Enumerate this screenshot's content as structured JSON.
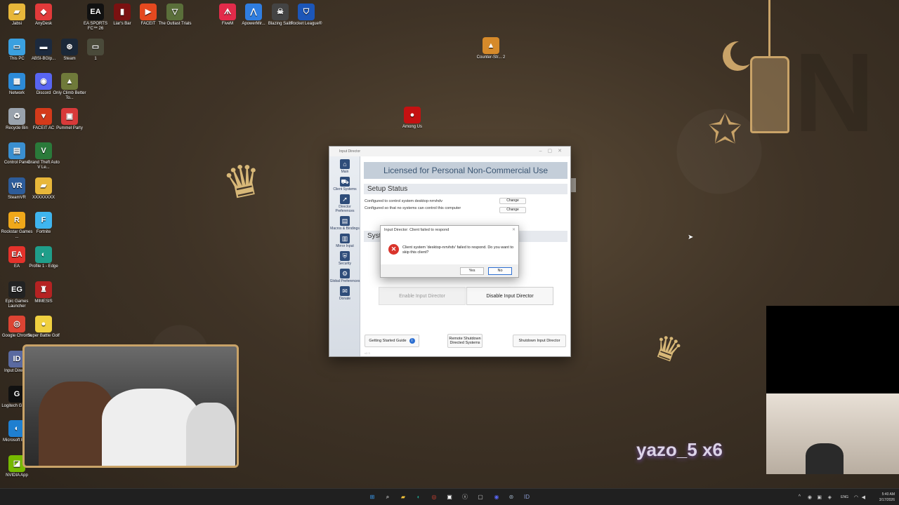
{
  "desktop": {
    "icons": [
      {
        "label": "Jabsi",
        "glyph": "▰",
        "color": "#e8b73a"
      },
      {
        "label": "AnyDesk",
        "glyph": "◆",
        "color": "#e23a3a"
      },
      {
        "label": "EA SPORTS FC™ 26",
        "glyph": "EA",
        "color": "#111111"
      },
      {
        "label": "Liar's Bar",
        "glyph": "▮",
        "color": "#7a1111"
      },
      {
        "label": "FACEIT",
        "glyph": "▶",
        "color": "#e5491f"
      },
      {
        "label": "The Outlast Trials",
        "glyph": "▽",
        "color": "#5a6f3a"
      },
      {
        "label": "FiveM",
        "glyph": "ᗑ",
        "color": "#e32b4a"
      },
      {
        "label": "ApowerMir...",
        "glyph": "⋀",
        "color": "#2f7de0"
      },
      {
        "label": "Blazing Sails",
        "glyph": "☠",
        "color": "#444444"
      },
      {
        "label": "Rocket League®",
        "glyph": "⛉",
        "color": "#1c56b8"
      },
      {
        "label": "Counter-Str... 2",
        "glyph": "▲",
        "color": "#d68a2a"
      },
      {
        "label": "This PC",
        "glyph": "▭",
        "color": "#3aa0e0"
      },
      {
        "label": "ABSI-BGIp...",
        "glyph": "▬",
        "color": "#1c2a3e"
      },
      {
        "label": "Steam",
        "glyph": "⊛",
        "color": "#1b2838"
      },
      {
        "label": "1",
        "glyph": "▭",
        "color": "#4a4a3a"
      },
      {
        "label": "Network",
        "glyph": "▦",
        "color": "#2d8bd8"
      },
      {
        "label": "Discord",
        "glyph": "◉",
        "color": "#5865f2"
      },
      {
        "label": "Only Climb Better To...",
        "glyph": "▲",
        "color": "#6f7a3a"
      },
      {
        "label": "Among Us",
        "glyph": "●",
        "color": "#c51111"
      },
      {
        "label": "Recycle Bin",
        "glyph": "♻",
        "color": "#9aa3ad"
      },
      {
        "label": "FACEIT AC",
        "glyph": "▼",
        "color": "#d43a1a"
      },
      {
        "label": "Pummel Party",
        "glyph": "▣",
        "color": "#d83a3a"
      },
      {
        "label": "Control Panel",
        "glyph": "▤",
        "color": "#3a8fd0"
      },
      {
        "label": "Grand Theft Auto V Le...",
        "glyph": "V",
        "color": "#2a7a3a"
      },
      {
        "label": "SteamVR",
        "glyph": "VR",
        "color": "#2d5c9a"
      },
      {
        "label": "XXXXXXXX",
        "glyph": "▰",
        "color": "#e8b73a"
      },
      {
        "label": "Rockstar Games ...",
        "glyph": "R",
        "color": "#f0a81a"
      },
      {
        "label": "Fortnite",
        "glyph": "F",
        "color": "#3fb5ef"
      },
      {
        "label": "EA",
        "glyph": "EA",
        "color": "#e4322b"
      },
      {
        "label": "Profile 1 - Edge",
        "glyph": "◐",
        "color": "#1f9e8a"
      },
      {
        "label": "Epic Games Launcher",
        "glyph": "EG",
        "color": "#222222"
      },
      {
        "label": "MIMESIS",
        "glyph": "♜",
        "color": "#b52222"
      },
      {
        "label": "Google Chrome",
        "glyph": "◎",
        "color": "#dd4433"
      },
      {
        "label": "Super Battle Golf",
        "glyph": "●",
        "color": "#f0d040"
      },
      {
        "label": "Input Director",
        "glyph": "ID",
        "color": "#5a6aa0"
      },
      {
        "label": "Logitech G HUB",
        "glyph": "G",
        "color": "#111111"
      },
      {
        "label": "Microsoft Edge",
        "glyph": "◐",
        "color": "#1e7fd0"
      },
      {
        "label": "NVIDIA App",
        "glyph": "◪",
        "color": "#76b900"
      }
    ]
  },
  "overlay": {
    "sub_alert": "yazo_5 x6"
  },
  "window": {
    "title": "Input Director",
    "licensed_banner": "Licensed for Personal Non-Commercial Use",
    "nav": [
      {
        "label": "Main",
        "glyph": "⌂"
      },
      {
        "label": "Client Systems",
        "glyph": "⛟"
      },
      {
        "label": "Director Preferences",
        "glyph": "➚"
      },
      {
        "label": "Macros & Bindings",
        "glyph": "▤"
      },
      {
        "label": "Mirror Input",
        "glyph": "▥"
      },
      {
        "label": "Security",
        "glyph": "⛨"
      },
      {
        "label": "Global Preferences",
        "glyph": "⚙"
      },
      {
        "label": "Donate",
        "glyph": "✉"
      }
    ],
    "setup_status": "Setup Status",
    "config_line_1": "Configured to control system desktop-nrrvhdv",
    "config_line_2": "Configured so that no systems can control this computer",
    "change_label": "Change",
    "systems_header": "Syst",
    "enable_label": "Enable Input Director",
    "disable_label": "Disable Input Director",
    "getting_started_label": "Getting Started Guide",
    "info_glyph": "i",
    "remote_shutdown_label": "Remote Shutdown Directed Systems",
    "shutdown_label": "Shutdown Input Director",
    "version": "v2.3"
  },
  "dialog": {
    "title": "Input Director: Client failed to respond",
    "message": "Client system 'desktop-nrrvhdv' failed to respond. Do you want to skip this client?",
    "yes_label": "Yes",
    "no_label": "No",
    "error_glyph": "✕",
    "close_glyph": "✕"
  },
  "taskbar": {
    "apps": [
      {
        "name": "start",
        "glyph": "⊞",
        "color": "#3a9bf0"
      },
      {
        "name": "search",
        "glyph": "⌕",
        "color": "#ffffff"
      },
      {
        "name": "file-explorer",
        "glyph": "▰",
        "color": "#f3c33a"
      },
      {
        "name": "edge",
        "glyph": "◐",
        "color": "#1f9e8a"
      },
      {
        "name": "chrome",
        "glyph": "◎",
        "color": "#dd4433"
      },
      {
        "name": "store",
        "glyph": "▣",
        "color": "#ffffff"
      },
      {
        "name": "xbox",
        "glyph": "ⓧ",
        "color": "#cccccc"
      },
      {
        "name": "terminal",
        "glyph": "▢",
        "color": "#cccccc"
      },
      {
        "name": "discord",
        "glyph": "◉",
        "color": "#5865f2"
      },
      {
        "name": "steam",
        "glyph": "⊛",
        "color": "#9ab"
      },
      {
        "name": "input-director",
        "glyph": "ID",
        "color": "#8a9ad0"
      }
    ],
    "language": "ENG",
    "time": "5:40 AM",
    "date": "3/17/2026"
  }
}
